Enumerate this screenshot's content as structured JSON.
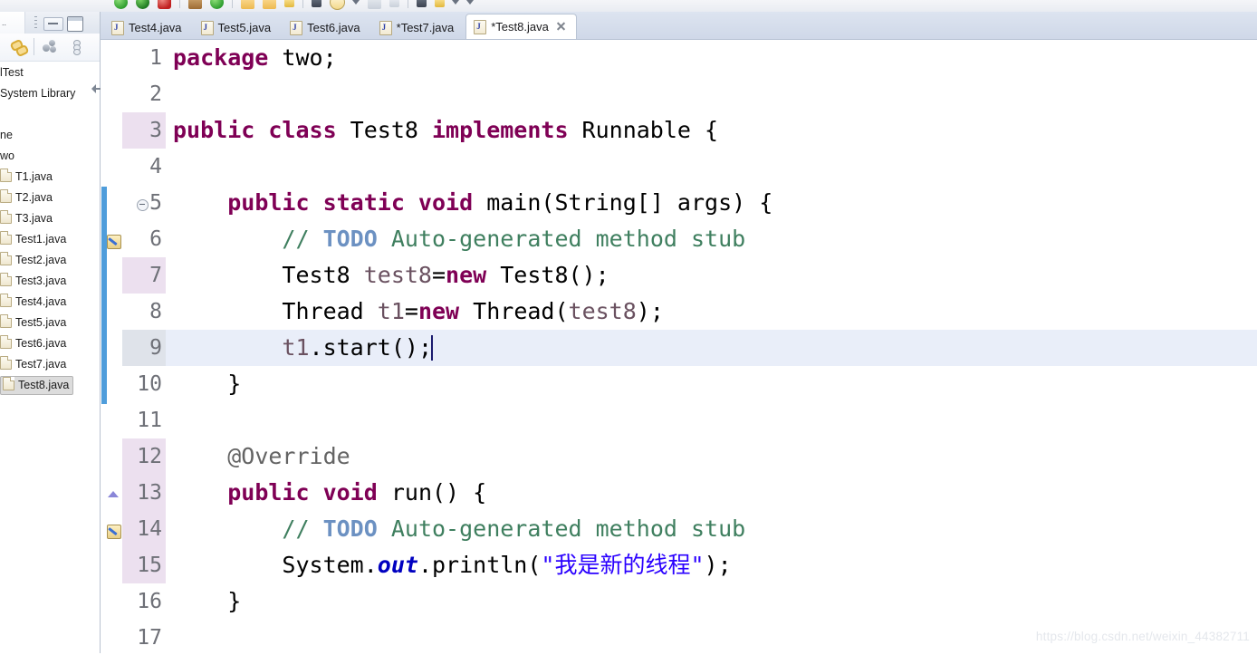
{
  "toolbar": {
    "icons": [
      "run-icon",
      "debug-icon",
      "stop-icon",
      "coverage-icon",
      "run-last-icon",
      "open-type-icon",
      "open-resource-icon",
      "search-icon",
      "perspective-icon",
      "console-icon",
      "dropdown-icon"
    ]
  },
  "left_panel": {
    "view_tab_label": "..",
    "minimize_tooltip": "Minimize",
    "maximize_tooltip": "Maximize",
    "toolbar_icons": [
      "link-with-editor-icon",
      "collapse-all-icon",
      "view-menu-icon"
    ],
    "tree": [
      {
        "label": "lTest",
        "type": "project",
        "selected": false
      },
      {
        "label": "System Library",
        "type": "library",
        "selected": false
      },
      {
        "label": "",
        "type": "spacer",
        "selected": false
      },
      {
        "label": "ne",
        "type": "package",
        "selected": false
      },
      {
        "label": "wo",
        "type": "package",
        "selected": false
      },
      {
        "label": "T1.java",
        "type": "file",
        "selected": false
      },
      {
        "label": "T2.java",
        "type": "file",
        "selected": false
      },
      {
        "label": "T3.java",
        "type": "file",
        "selected": false
      },
      {
        "label": "Test1.java",
        "type": "file",
        "selected": false
      },
      {
        "label": "Test2.java",
        "type": "file",
        "selected": false
      },
      {
        "label": "Test3.java",
        "type": "file",
        "selected": false
      },
      {
        "label": "Test4.java",
        "type": "file",
        "selected": false
      },
      {
        "label": "Test5.java",
        "type": "file",
        "selected": false
      },
      {
        "label": "Test6.java",
        "type": "file",
        "selected": false
      },
      {
        "label": "Test7.java",
        "type": "file",
        "selected": false
      },
      {
        "label": "Test8.java",
        "type": "file",
        "selected": true
      }
    ]
  },
  "editor": {
    "tabs": [
      {
        "label": "Test4.java",
        "active": false,
        "dirty": false,
        "closable": false
      },
      {
        "label": "Test5.java",
        "active": false,
        "dirty": false,
        "closable": false
      },
      {
        "label": "Test6.java",
        "active": false,
        "dirty": false,
        "closable": false
      },
      {
        "label": "*Test7.java",
        "active": false,
        "dirty": true,
        "closable": false
      },
      {
        "label": "*Test8.java",
        "active": true,
        "dirty": true,
        "closable": true
      }
    ],
    "current_line": 9,
    "occurrence_highlight_lines": [
      3,
      7,
      12,
      13,
      14,
      15
    ],
    "change_bar_lines": [
      5,
      6,
      7,
      8,
      9,
      10
    ],
    "gutter_markers": [
      {
        "line": 5,
        "marker": "fold-collapse-icon"
      },
      {
        "line": 6,
        "marker": "todo-task-icon"
      },
      {
        "line": 12,
        "marker": "fold-collapse-icon"
      },
      {
        "line": 13,
        "marker": "override-indicator-icon"
      },
      {
        "line": 14,
        "marker": "todo-task-icon"
      }
    ],
    "line_numbers": [
      "1",
      "2",
      "3",
      "4",
      "5",
      "6",
      "7",
      "8",
      "9",
      "10",
      "11",
      "12",
      "13",
      "14",
      "15",
      "16",
      "17"
    ],
    "code_lines": [
      {
        "n": "1",
        "tokens": [
          {
            "t": "package",
            "c": "kw"
          },
          {
            "t": " two;",
            "c": ""
          }
        ]
      },
      {
        "n": "2",
        "tokens": []
      },
      {
        "n": "3",
        "tokens": [
          {
            "t": "public class",
            "c": "kw"
          },
          {
            "t": " Test8 ",
            "c": ""
          },
          {
            "t": "implements",
            "c": "kw"
          },
          {
            "t": " Runnable {",
            "c": ""
          }
        ]
      },
      {
        "n": "4",
        "tokens": []
      },
      {
        "n": "5",
        "tokens": [
          {
            "t": "    ",
            "c": ""
          },
          {
            "t": "public static void",
            "c": "kw"
          },
          {
            "t": " main(String[] args) {",
            "c": ""
          }
        ]
      },
      {
        "n": "6",
        "tokens": [
          {
            "t": "        ",
            "c": ""
          },
          {
            "t": "// ",
            "c": "cm"
          },
          {
            "t": "TODO",
            "c": "todo"
          },
          {
            "t": " Auto-generated method stub",
            "c": "cm"
          }
        ]
      },
      {
        "n": "7",
        "tokens": [
          {
            "t": "        Test8 ",
            "c": ""
          },
          {
            "t": "test8",
            "c": "loc"
          },
          {
            "t": "=",
            "c": ""
          },
          {
            "t": "new",
            "c": "kw"
          },
          {
            "t": " Test8();",
            "c": ""
          }
        ]
      },
      {
        "n": "8",
        "tokens": [
          {
            "t": "        Thread ",
            "c": ""
          },
          {
            "t": "t1",
            "c": "loc"
          },
          {
            "t": "=",
            "c": ""
          },
          {
            "t": "new",
            "c": "kw"
          },
          {
            "t": " Thread(",
            "c": ""
          },
          {
            "t": "test8",
            "c": "loc"
          },
          {
            "t": ");",
            "c": ""
          }
        ]
      },
      {
        "n": "9",
        "tokens": [
          {
            "t": "        ",
            "c": ""
          },
          {
            "t": "t1",
            "c": "loc"
          },
          {
            "t": ".start();",
            "c": ""
          }
        ]
      },
      {
        "n": "10",
        "tokens": [
          {
            "t": "    }",
            "c": ""
          }
        ]
      },
      {
        "n": "11",
        "tokens": []
      },
      {
        "n": "12",
        "tokens": [
          {
            "t": "    ",
            "c": ""
          },
          {
            "t": "@Override",
            "c": "ann"
          }
        ]
      },
      {
        "n": "13",
        "tokens": [
          {
            "t": "    ",
            "c": ""
          },
          {
            "t": "public void",
            "c": "kw"
          },
          {
            "t": " run() {",
            "c": ""
          }
        ]
      },
      {
        "n": "14",
        "tokens": [
          {
            "t": "        ",
            "c": ""
          },
          {
            "t": "// ",
            "c": "cm"
          },
          {
            "t": "TODO",
            "c": "todo"
          },
          {
            "t": " Auto-generated method stub",
            "c": "cm"
          }
        ]
      },
      {
        "n": "15",
        "tokens": [
          {
            "t": "        System.",
            "c": ""
          },
          {
            "t": "out",
            "c": "fld"
          },
          {
            "t": ".println(",
            "c": ""
          },
          {
            "t": "\"我是新的线程\"",
            "c": "str"
          },
          {
            "t": ");",
            "c": ""
          }
        ]
      },
      {
        "n": "16",
        "tokens": [
          {
            "t": "    }",
            "c": ""
          }
        ]
      },
      {
        "n": "17",
        "tokens": []
      }
    ]
  },
  "watermark": {
    "text": "https://blog.csdn.net/weixin_44382711"
  },
  "colors": {
    "keyword": "#7F0055",
    "comment": "#3F7F5F",
    "todo_tag": "#6C91C2",
    "string": "#2A00FF",
    "static_field": "#0000C0",
    "local_var": "#6A5160",
    "annotation": "#646464",
    "current_line_bg": "#E9EEF9",
    "occurrence_bg": "#ECE0EF",
    "tabbar_bg": "#D6DEEC",
    "change_bar": "#4F9DDB"
  }
}
